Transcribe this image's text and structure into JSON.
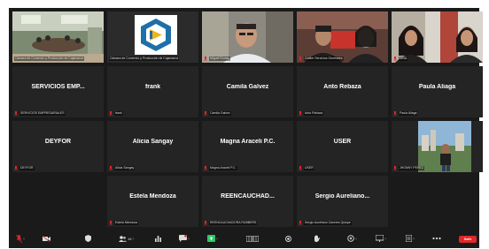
{
  "colors": {
    "tile_bg": "#242424",
    "window_bg": "#1a1a1a",
    "active_border": "#b9d85a",
    "muted_red": "#e02828",
    "share_green": "#2ec866",
    "leave_red": "#e02828"
  },
  "tiles": [
    {
      "name": "",
      "footer": "Cámara de Comercio y Producción de Cajamarca",
      "video": true
    },
    {
      "name": "",
      "footer": "Cámara de Comercio y Producción de Cajamarca",
      "video": true
    },
    {
      "name": "",
      "footer": "Miguel Romar",
      "video": true
    },
    {
      "name": "",
      "footer": "Outlier Servicios Generales",
      "video": true
    },
    {
      "name": "",
      "footer": "NINA",
      "video": true
    },
    {
      "name": "SERVICIOS EMP...",
      "footer": "SERVICIOS EMPRESARIALES"
    },
    {
      "name": "frank",
      "footer": "frank"
    },
    {
      "name": "Camila Galvez",
      "footer": "Camila Galvez"
    },
    {
      "name": "Anto Rebaza",
      "footer": "Anto Rebaza"
    },
    {
      "name": "Paula Aliaga",
      "footer": "Paula Aliaga"
    },
    {
      "name": "DEYFOR",
      "footer": "DEYFOR"
    },
    {
      "name": "Alicia Sangay",
      "footer": "Alicia Sangay"
    },
    {
      "name": "Magna Araceli P.C.",
      "footer": "Magna Araceli P.C."
    },
    {
      "name": "USER",
      "footer": "USER"
    },
    {
      "name": "",
      "footer": "JHONNY PEREZ",
      "video": true
    },
    {
      "name": "Estela Mendoza",
      "footer": "Estela Mendoza"
    },
    {
      "name": "REENCAUCHAD...",
      "footer": "REENCAUCHADORA RUBBERS"
    },
    {
      "name": "Sergio  Aureliano...",
      "footer": "Sergio Aureliano Cáceres Quispe"
    }
  ],
  "toolbar": {
    "participants_count": "16",
    "leave_label": "Salir"
  },
  "icons": {
    "mic": "microphone-muted-icon",
    "video": "video-off-icon",
    "security": "shield-icon",
    "participants": "participants-icon",
    "polls": "bar-chart-icon",
    "chat": "chat-bubble-icon",
    "share": "share-screen-icon",
    "gallery": "gallery-view-icon",
    "record": "record-icon",
    "reactions": "hand-icon",
    "apps": "apps-icon",
    "whiteboard": "whiteboard-icon",
    "notes": "notes-icon",
    "more": "more-icon"
  }
}
